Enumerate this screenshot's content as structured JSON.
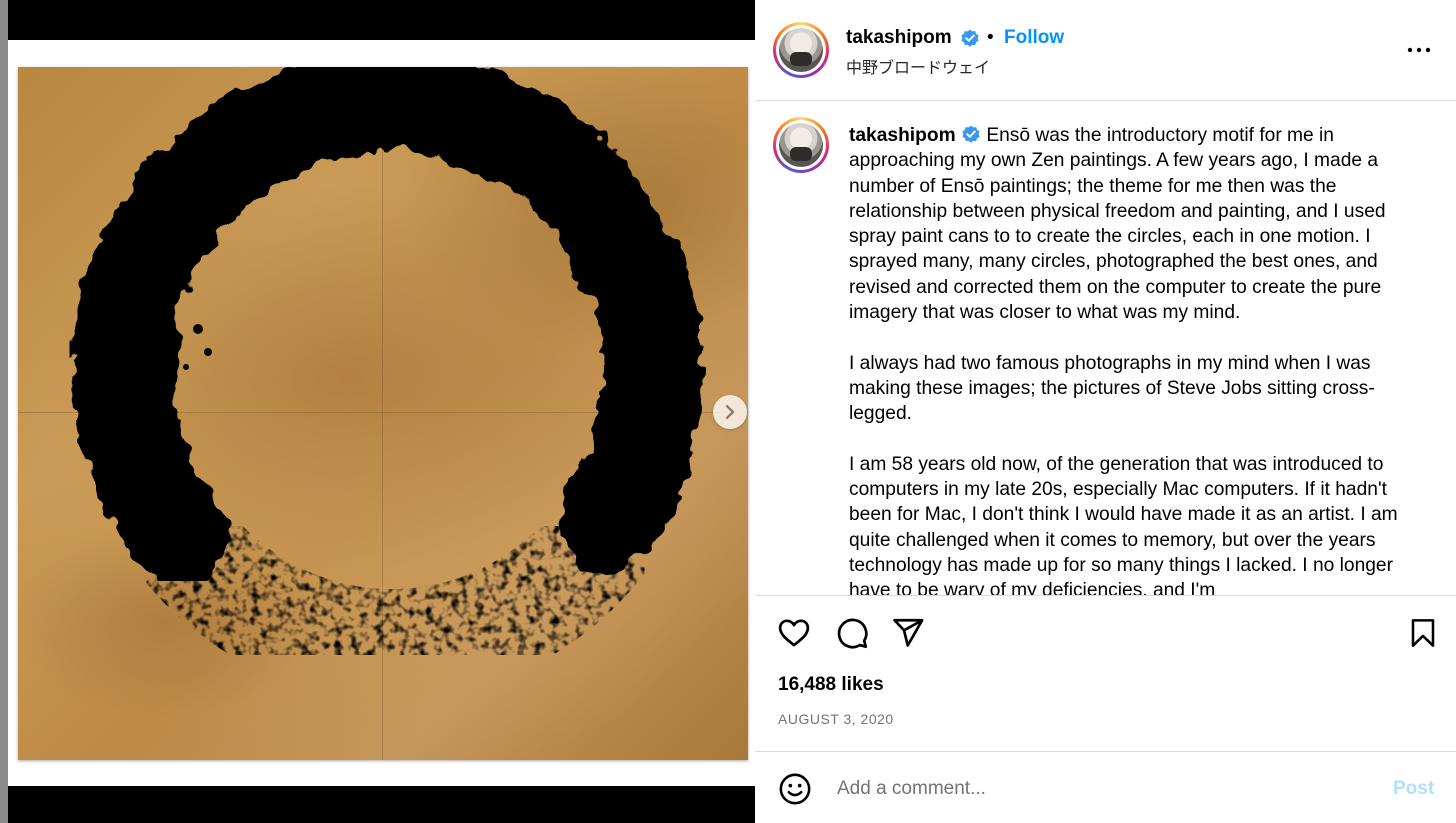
{
  "header": {
    "username": "takashipom",
    "separator": "•",
    "follow_label": "Follow",
    "location": "中野ブロードウェイ"
  },
  "caption": {
    "username": "takashipom",
    "paragraphs": [
      "Ensō was the introductory motif for me in approaching my own Zen paintings. A few years ago, I made a number of Ensō paintings; the theme for me then was the relationship between physical freedom and painting, and I used spray paint cans to to create the circles, each in one motion. I sprayed many, many circles, photographed the best ones, and revised and corrected them on the computer to create the pure imagery that was closer to what was my mind.",
      "I always had two famous photographs in my mind when I was making these images; the pictures of Steve Jobs sitting cross-legged.",
      "I am 58 years old now, of the generation that was introduced to computers in my late 20s, especially Mac computers. If it hadn't been for Mac, I don't think I would have made it as an artist. I am quite challenged when it comes to memory, but over the years technology has made up for so many things I lacked. I no longer have to be wary of my deficiencies, and I'm"
    ]
  },
  "likes_text": "16,488 likes",
  "date_text": "AUGUST 3, 2020",
  "comment": {
    "placeholder": "Add a comment...",
    "post_label": "Post"
  },
  "icons": {
    "verified": "verified-badge-icon",
    "more": "more-options-icon",
    "like": "heart-icon",
    "comment": "comment-bubble-icon",
    "share": "paper-plane-icon",
    "save": "bookmark-icon",
    "emoji": "smiley-icon",
    "next": "chevron-right-icon"
  },
  "colors": {
    "link_blue": "#0095f6",
    "post_disabled": "#b2dffc",
    "muted_text": "#737373",
    "divider": "#dbdbdb"
  }
}
